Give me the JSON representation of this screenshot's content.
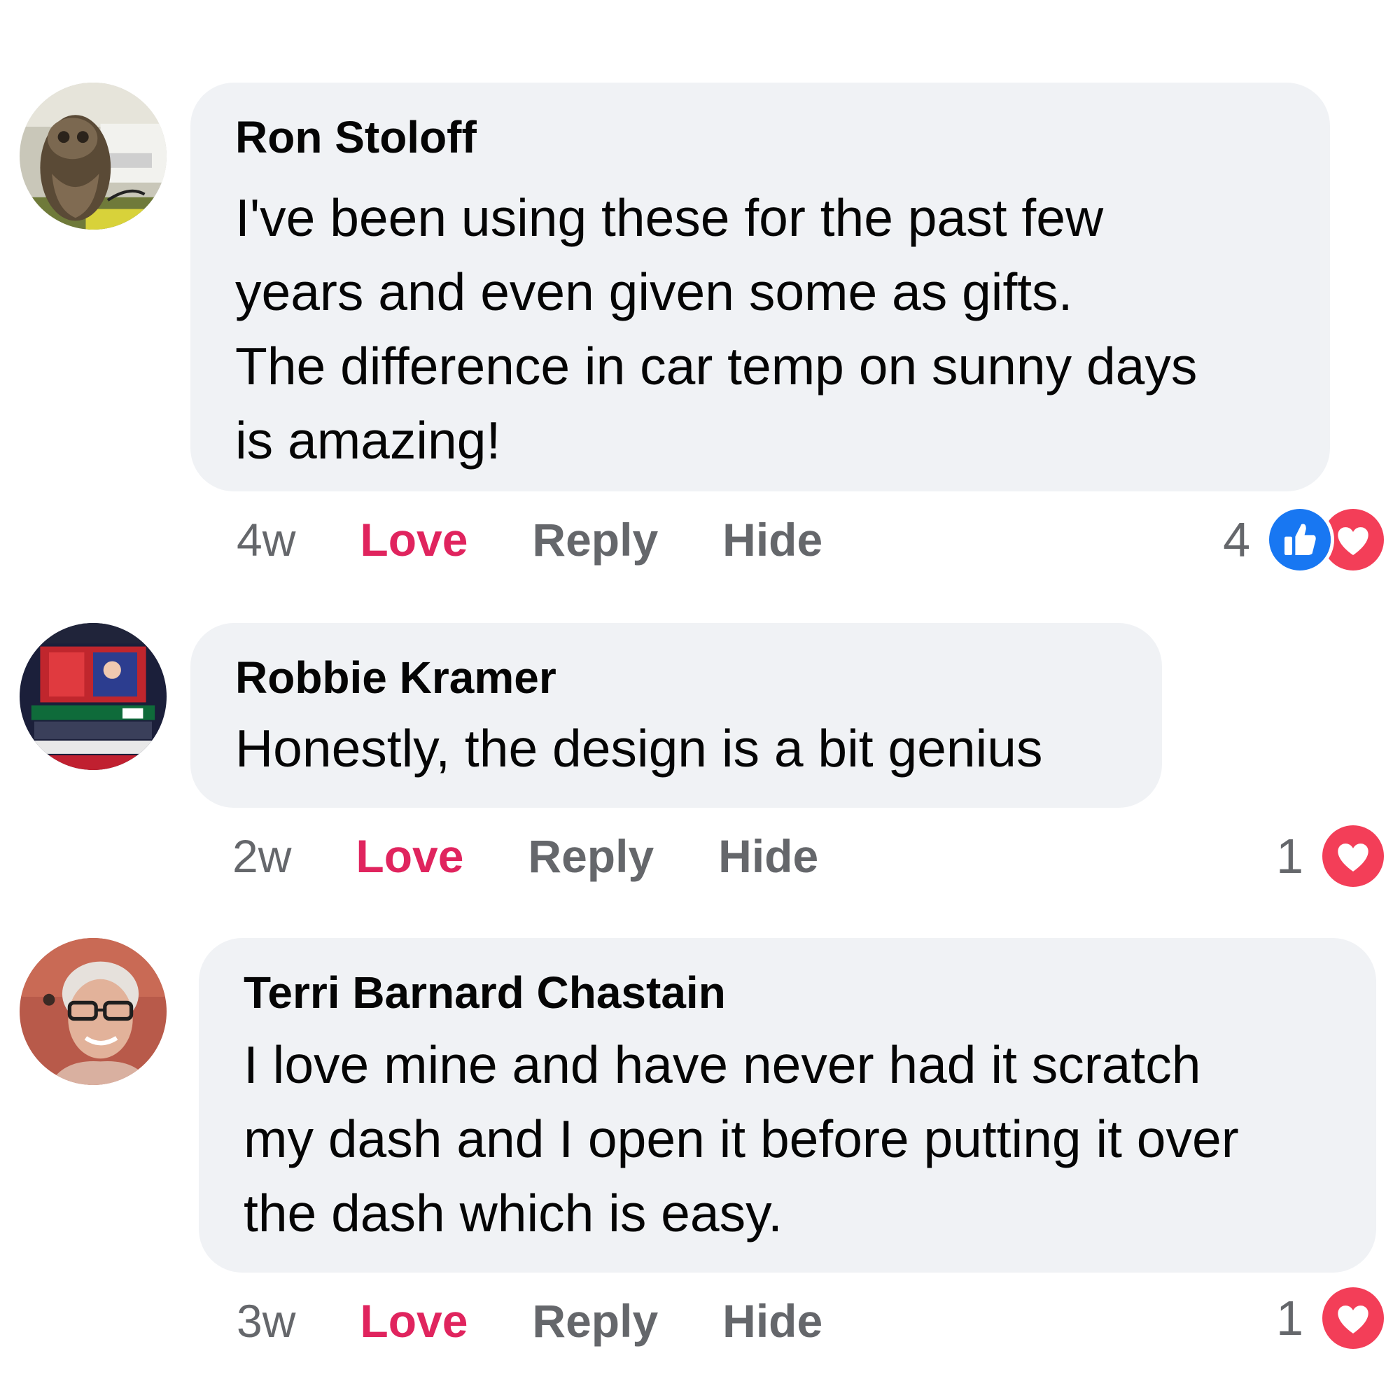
{
  "comments": [
    {
      "author": "Ron Stoloff",
      "text": "I've been using these for the past few\nyears and even given some as gifts.\nThe difference in car temp on sunny days\nis amazing!",
      "time": "4w",
      "love_label": "Love",
      "reply_label": "Reply",
      "hide_label": "Hide",
      "reaction_count": "4",
      "reactions": [
        "like-icon",
        "heart-icon"
      ],
      "avatar": "owl-avatar"
    },
    {
      "author": "Robbie Kramer",
      "text": "Honestly, the design is a bit genius",
      "time": "2w",
      "love_label": "Love",
      "reply_label": "Reply",
      "hide_label": "Hide",
      "reaction_count": "1",
      "reactions": [
        "heart-icon"
      ],
      "avatar": "arena-avatar"
    },
    {
      "author": "Terri Barnard Chastain",
      "text": "I love mine and have never had it scratch\nmy dash and I open it before putting it over\nthe dash which is easy.",
      "time": "3w",
      "love_label": "Love",
      "reply_label": "Reply",
      "hide_label": "Hide",
      "reaction_count": "1",
      "reactions": [
        "heart-icon"
      ],
      "avatar": "person-avatar"
    }
  ],
  "colors": {
    "bubble": "#f0f2f5",
    "love": "#e0245e",
    "muted": "#65676b",
    "like_blue": "#1877f2",
    "heart_red": "#f33e58"
  }
}
